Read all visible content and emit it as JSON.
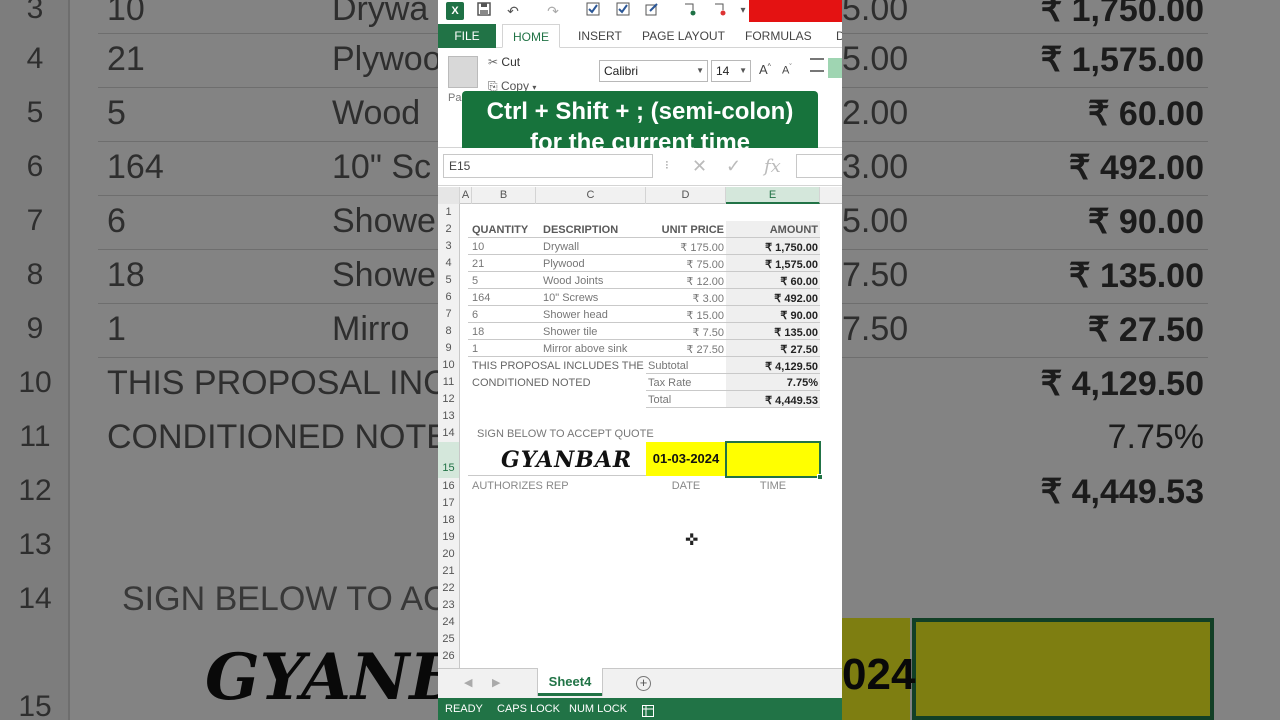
{
  "tabs": [
    "FILE",
    "HOME",
    "INSERT",
    "PAGE LAYOUT",
    "FORMULAS",
    "D"
  ],
  "ribbon": {
    "cut_label": "Cut",
    "copy_label": "Copy",
    "paste_label": "Pa",
    "font_name": "Calibri",
    "font_size": "14",
    "grow": "A",
    "shrink": "A"
  },
  "tip": {
    "line1": "Ctrl + Shift + ; (semi-colon)",
    "line2": "for the current time"
  },
  "formula_bar": {
    "name_box": "E15",
    "sep": "⁝",
    "cancel": "✕",
    "enter": "✓",
    "fx": "fx"
  },
  "columns": [
    "A",
    "B",
    "C",
    "D",
    "E"
  ],
  "rows": [
    "1",
    "2",
    "3",
    "4",
    "5",
    "6",
    "7",
    "8",
    "9",
    "10",
    "11",
    "12",
    "13",
    "14",
    "15",
    "16",
    "17",
    "18",
    "19",
    "20",
    "21",
    "22",
    "23",
    "24",
    "25",
    "26"
  ],
  "headers": {
    "quantity": "QUANTITY",
    "description": "DESCRIPTION",
    "unit_price": "UNIT PRICE",
    "amount": "AMOUNT"
  },
  "items": [
    {
      "qty": "10",
      "desc": "Drywall",
      "price": "₹ 175.00",
      "amount": "₹ 1,750.00"
    },
    {
      "qty": "21",
      "desc": "Plywood",
      "price": "₹ 75.00",
      "amount": "₹ 1,575.00"
    },
    {
      "qty": "5",
      "desc": "Wood Joints",
      "price": "₹ 12.00",
      "amount": "₹ 60.00"
    },
    {
      "qty": "164",
      "desc": "10\" Screws",
      "price": "₹ 3.00",
      "amount": "₹ 492.00"
    },
    {
      "qty": "6",
      "desc": "Shower head",
      "price": "₹ 15.00",
      "amount": "₹ 90.00"
    },
    {
      "qty": "18",
      "desc": "Shower tile",
      "price": "₹ 7.50",
      "amount": "₹ 135.00"
    },
    {
      "qty": "1",
      "desc": "Mirror above sink",
      "price": "₹ 27.50",
      "amount": "₹ 27.50"
    }
  ],
  "proposal": {
    "line1": "THIS PROPOSAL INCLUDES THE",
    "line2": "CONDITIONED NOTED"
  },
  "totals": {
    "subtotal_label": "Subtotal",
    "subtotal": "₹ 4,129.50",
    "tax_label": "Tax Rate",
    "tax": "7.75%",
    "total_label": "Total",
    "total": "₹ 4,449.53"
  },
  "sign": {
    "prompt": "SIGN BELOW TO ACCEPT QUOTE",
    "signature": "GYANBAR",
    "date": "01-03-2024",
    "rep_label": "AUTHORIZES REP",
    "date_label": "DATE",
    "time_label": "TIME"
  },
  "sheet_tab": "Sheet4",
  "status": {
    "ready": "READY",
    "caps": "CAPS LOCK",
    "num": "NUM LOCK"
  },
  "colors": {
    "excel_green": "#217346",
    "highlight": "#ffff00",
    "qat_red": "#e41212"
  },
  "background": {
    "rows": [
      "3",
      "4",
      "5",
      "6",
      "7",
      "8",
      "9",
      "10",
      "11",
      "12",
      "13",
      "14",
      "15"
    ],
    "qty": [
      "10",
      "21",
      "5",
      "164",
      "6",
      "18",
      "1"
    ],
    "desc": [
      "Drywa",
      "Plywoo",
      "Wood",
      "10\" Sc",
      "Showe",
      "Showe",
      "Mirro"
    ],
    "mid": [
      "5.00",
      "5.00",
      "2.00",
      "3.00",
      "5.00",
      "7.50",
      "7.50"
    ],
    "amounts": [
      "₹ 1,750.00",
      "₹ 1,575.00",
      "₹ 60.00",
      "₹ 492.00",
      "₹ 90.00",
      "₹ 135.00",
      "₹ 27.50"
    ],
    "proposal1": "THIS PROPOSAL INCL",
    "proposal2": "CONDITIONED NOTE",
    "subtotal": "₹ 4,129.50",
    "tax": "7.75%",
    "total": "₹ 4,449.53",
    "sign": "SIGN BELOW TO AC",
    "sig": "GYANB",
    "date_fragment": "024"
  }
}
